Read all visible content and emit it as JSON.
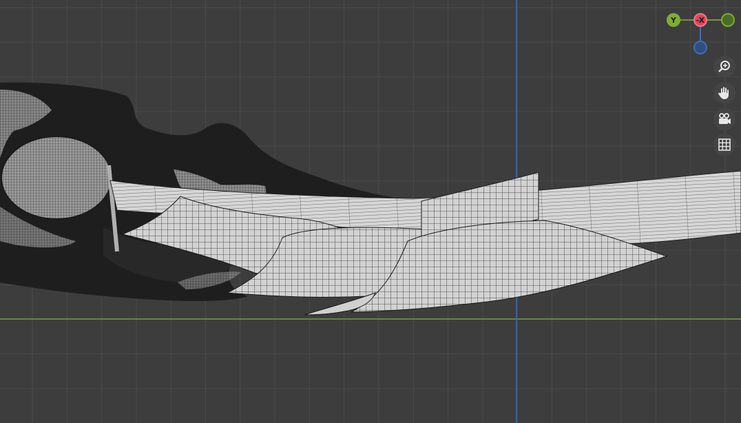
{
  "viewport": {
    "background_color": "#3d3d3d",
    "grid_color": "#4b4b4b",
    "x_axis_color": "#6d9d3a",
    "z_axis_color": "#3f6cb6",
    "mesh_light_color": "#cfcfcf",
    "mesh_dark_color": "#1f1f1f"
  },
  "gizmo": {
    "y_label": "Y",
    "neg_x_label": "-X",
    "y_color": "#7fae2e",
    "x_color": "#e2435a",
    "z_color": "#3e6fb5"
  },
  "nav_buttons": [
    {
      "name": "zoom-icon",
      "icon": "magnifier-plus"
    },
    {
      "name": "pan-hand-icon",
      "icon": "hand"
    },
    {
      "name": "camera-icon",
      "icon": "camera"
    },
    {
      "name": "grid-icon",
      "icon": "grid"
    }
  ]
}
